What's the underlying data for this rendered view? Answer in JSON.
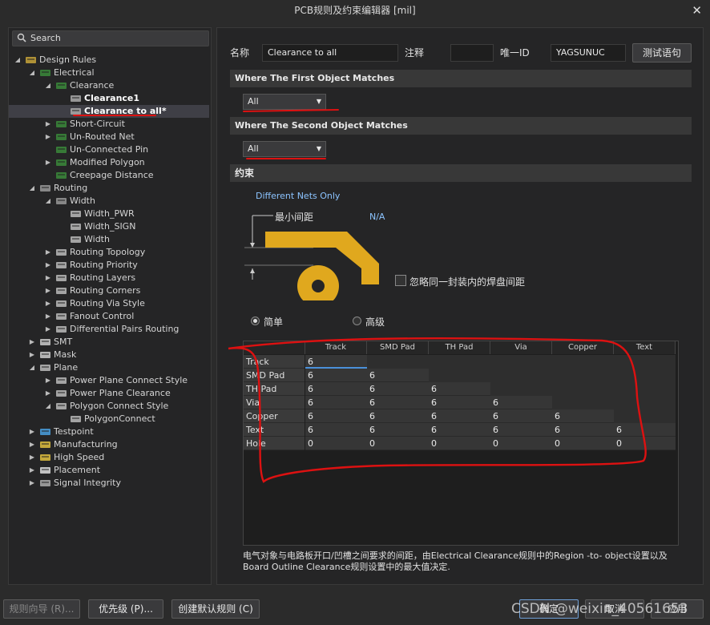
{
  "window": {
    "title": "PCB规则及约束编辑器 [mil]",
    "close_glyph": "✕"
  },
  "search": {
    "placeholder": "Search"
  },
  "tree": [
    {
      "label": "Design Rules",
      "arrow": "◢",
      "icon": "design-rules-icon",
      "level": 0,
      "bold": false
    },
    {
      "label": "Electrical",
      "arrow": "◢",
      "icon": "electrical-icon",
      "level": 1
    },
    {
      "label": "Clearance",
      "arrow": "◢",
      "icon": "clearance-icon",
      "level": 2
    },
    {
      "label": "Clearance1",
      "arrow": "",
      "icon": "rule-icon",
      "level": 3,
      "bold": true
    },
    {
      "label": "Clearance to all*",
      "arrow": "",
      "icon": "rule-icon",
      "level": 3,
      "bold": true,
      "selected": true
    },
    {
      "label": "Short-Circuit",
      "arrow": "▶",
      "icon": "short-circuit-icon",
      "level": 2
    },
    {
      "label": "Un-Routed Net",
      "arrow": "▶",
      "icon": "unrouted-net-icon",
      "level": 2
    },
    {
      "label": "Un-Connected Pin",
      "arrow": "",
      "icon": "unconnected-pin-icon",
      "level": 2
    },
    {
      "label": "Modified Polygon",
      "arrow": "▶",
      "icon": "modified-polygon-icon",
      "level": 2
    },
    {
      "label": "Creepage Distance",
      "arrow": "",
      "icon": "creepage-icon",
      "level": 2
    },
    {
      "label": "Routing",
      "arrow": "◢",
      "icon": "routing-icon",
      "level": 1
    },
    {
      "label": "Width",
      "arrow": "◢",
      "icon": "width-icon",
      "level": 2
    },
    {
      "label": "Width_PWR",
      "arrow": "",
      "icon": "width-rule-icon",
      "level": 3
    },
    {
      "label": "Width_SIGN",
      "arrow": "",
      "icon": "width-rule-icon",
      "level": 3
    },
    {
      "label": "Width",
      "arrow": "",
      "icon": "width-rule-icon",
      "level": 3
    },
    {
      "label": "Routing Topology",
      "arrow": "▶",
      "icon": "routing-rule-icon",
      "level": 2
    },
    {
      "label": "Routing Priority",
      "arrow": "▶",
      "icon": "routing-rule-icon",
      "level": 2
    },
    {
      "label": "Routing Layers",
      "arrow": "▶",
      "icon": "routing-rule-icon",
      "level": 2
    },
    {
      "label": "Routing Corners",
      "arrow": "▶",
      "icon": "routing-rule-icon",
      "level": 2
    },
    {
      "label": "Routing Via Style",
      "arrow": "▶",
      "icon": "routing-rule-icon",
      "level": 2
    },
    {
      "label": "Fanout Control",
      "arrow": "▶",
      "icon": "routing-rule-icon",
      "level": 2
    },
    {
      "label": "Differential Pairs Routing",
      "arrow": "▶",
      "icon": "routing-rule-icon",
      "level": 2
    },
    {
      "label": "SMT",
      "arrow": "▶",
      "icon": "smt-icon",
      "level": 1
    },
    {
      "label": "Mask",
      "arrow": "▶",
      "icon": "mask-icon",
      "level": 1
    },
    {
      "label": "Plane",
      "arrow": "◢",
      "icon": "plane-icon",
      "level": 1
    },
    {
      "label": "Power Plane Connect Style",
      "arrow": "▶",
      "icon": "plane-rule-icon",
      "level": 2
    },
    {
      "label": "Power Plane Clearance",
      "arrow": "▶",
      "icon": "plane-rule-icon",
      "level": 2
    },
    {
      "label": "Polygon Connect Style",
      "arrow": "◢",
      "icon": "plane-rule-icon",
      "level": 2
    },
    {
      "label": "PolygonConnect",
      "arrow": "",
      "icon": "plane-rule-icon",
      "level": 3
    },
    {
      "label": "Testpoint",
      "arrow": "▶",
      "icon": "testpoint-icon",
      "level": 1
    },
    {
      "label": "Manufacturing",
      "arrow": "▶",
      "icon": "manufacturing-icon",
      "level": 1
    },
    {
      "label": "High Speed",
      "arrow": "▶",
      "icon": "high-speed-icon",
      "level": 1
    },
    {
      "label": "Placement",
      "arrow": "▶",
      "icon": "placement-icon",
      "level": 1
    },
    {
      "label": "Signal Integrity",
      "arrow": "▶",
      "icon": "signal-integrity-icon",
      "level": 1
    }
  ],
  "header": {
    "name_label": "名称",
    "name_value": "Clearance to all",
    "comment_label": "注释",
    "comment_value": "",
    "uid_label": "唯一ID",
    "uid_value": "YAGSUNUC",
    "test_button": "测试语句"
  },
  "first_match": {
    "title": "Where The First Object Matches",
    "value": "All"
  },
  "second_match": {
    "title": "Where The Second Object Matches",
    "value": "All"
  },
  "constraints": {
    "title": "约束",
    "net_scope": "Different Nets Only",
    "min_clearance_label": "最小间距",
    "min_clearance_value": "N/A",
    "ignore_pad_label": "忽略同一封装内的焊盘间距",
    "mode_simple": "简单",
    "mode_advanced": "高级",
    "mode_selected": "simple"
  },
  "clearance_grid": {
    "columns": [
      "Track",
      "SMD Pad",
      "TH Pad",
      "Via",
      "Copper",
      "Text"
    ],
    "rows": [
      {
        "name": "Track",
        "values": [
          "6"
        ]
      },
      {
        "name": "SMD Pad",
        "values": [
          "6",
          "6"
        ]
      },
      {
        "name": "TH Pad",
        "values": [
          "6",
          "6",
          "6"
        ]
      },
      {
        "name": "Via",
        "values": [
          "6",
          "6",
          "6",
          "6"
        ]
      },
      {
        "name": "Copper",
        "values": [
          "6",
          "6",
          "6",
          "6",
          "6"
        ]
      },
      {
        "name": "Text",
        "values": [
          "6",
          "6",
          "6",
          "6",
          "6",
          "6"
        ]
      },
      {
        "name": "Hole",
        "values": [
          "0",
          "0",
          "0",
          "0",
          "0",
          "0"
        ]
      }
    ]
  },
  "note": "电气对象与电路板开口/凹槽之间要求的间距，由Electrical Clearance规则中的Region -to- object设置以及Board Outline Clearance规则设置中的最大值决定.",
  "footer": {
    "wizard": "规则向导 (R)...",
    "priority": "优先级 (P)...",
    "create_default": "创建默认规则 (C)",
    "ok": "确定",
    "cancel": "取消",
    "apply": "应用",
    "watermark": "CSDN @weixin_40561653"
  },
  "colors": {
    "accent_red": "#dd1111",
    "copper_yellow": "#e0a81e",
    "bg_dark": "#252526"
  }
}
